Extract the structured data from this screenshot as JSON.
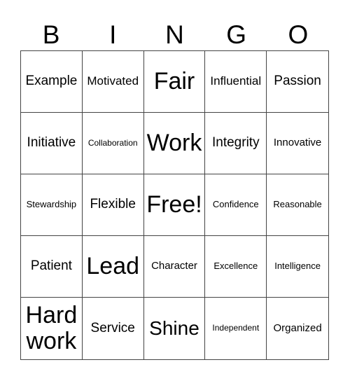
{
  "header": [
    "B",
    "I",
    "N",
    "G",
    "O"
  ],
  "cells": [
    {
      "text": "Example",
      "size": "s-m"
    },
    {
      "text": "Motivated",
      "size": "s-ms"
    },
    {
      "text": "Fair",
      "size": "s-xl"
    },
    {
      "text": "Influential",
      "size": "s-ms"
    },
    {
      "text": "Passion",
      "size": "s-m"
    },
    {
      "text": "Initiative",
      "size": "s-m"
    },
    {
      "text": "Collaboration",
      "size": "s-xxs"
    },
    {
      "text": "Work",
      "size": "s-xl"
    },
    {
      "text": "Integrity",
      "size": "s-m"
    },
    {
      "text": "Innovative",
      "size": "s-s"
    },
    {
      "text": "Stewardship",
      "size": "s-xs"
    },
    {
      "text": "Flexible",
      "size": "s-m"
    },
    {
      "text": "Free!",
      "size": "s-xl"
    },
    {
      "text": "Confidence",
      "size": "s-xs"
    },
    {
      "text": "Reasonable",
      "size": "s-xs"
    },
    {
      "text": "Patient",
      "size": "s-m"
    },
    {
      "text": "Lead",
      "size": "s-xl"
    },
    {
      "text": "Character",
      "size": "s-s"
    },
    {
      "text": "Excellence",
      "size": "s-xs"
    },
    {
      "text": "Intelligence",
      "size": "s-xs"
    },
    {
      "text": "Hard work",
      "size": "s-xl"
    },
    {
      "text": "Service",
      "size": "s-m"
    },
    {
      "text": "Shine",
      "size": "s-l"
    },
    {
      "text": "Independent",
      "size": "s-xxs"
    },
    {
      "text": "Organized",
      "size": "s-s"
    }
  ]
}
